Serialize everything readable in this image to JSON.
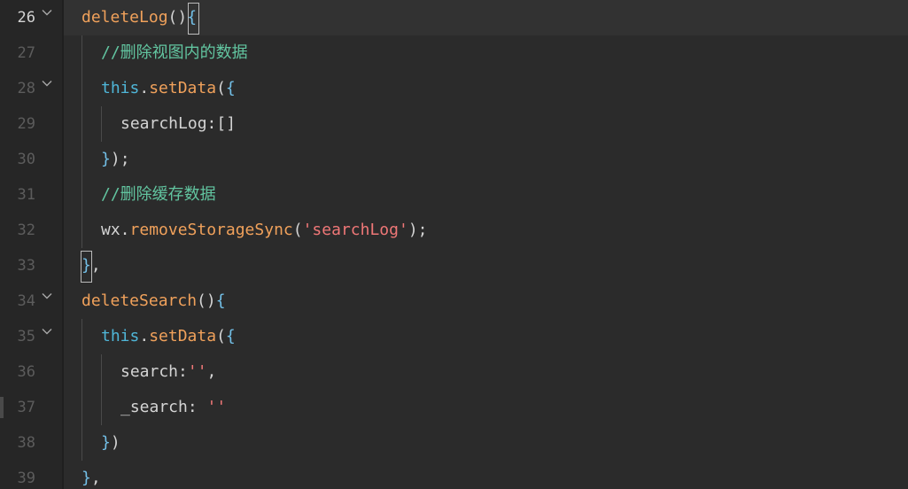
{
  "editor": {
    "current_line": "26",
    "lines": [
      {
        "num": "26",
        "tokens": [
          [
            "fn",
            "deleteLog"
          ],
          [
            "paren",
            "()"
          ],
          [
            "brace",
            "{"
          ]
        ]
      },
      {
        "num": "27",
        "tokens": [
          [
            "cm",
            "//删除视图内的数据"
          ]
        ]
      },
      {
        "num": "28",
        "tokens": [
          [
            "kw",
            "this"
          ],
          [
            "punct",
            "."
          ],
          [
            "fn",
            "setData"
          ],
          [
            "paren",
            "("
          ],
          [
            "brace",
            "{"
          ]
        ]
      },
      {
        "num": "29",
        "tokens": [
          [
            "punct",
            "searchLog:[]"
          ]
        ]
      },
      {
        "num": "30",
        "tokens": [
          [
            "brace",
            "}"
          ],
          [
            "paren",
            ")"
          ],
          [
            "punct",
            ";"
          ]
        ]
      },
      {
        "num": "31",
        "tokens": [
          [
            "cm",
            "//删除缓存数据"
          ]
        ]
      },
      {
        "num": "32",
        "tokens": [
          [
            "punct",
            "wx."
          ],
          [
            "fn",
            "removeStorageSync"
          ],
          [
            "paren",
            "("
          ],
          [
            "str",
            "'searchLog'"
          ],
          [
            "paren",
            ")"
          ],
          [
            "punct",
            ";"
          ]
        ]
      },
      {
        "num": "33",
        "tokens": [
          [
            "brace",
            "}"
          ],
          [
            "punct",
            ","
          ]
        ]
      },
      {
        "num": "34",
        "tokens": [
          [
            "fn",
            "deleteSearch"
          ],
          [
            "paren",
            "()"
          ],
          [
            "brace",
            "{"
          ]
        ]
      },
      {
        "num": "35",
        "tokens": [
          [
            "kw",
            "this"
          ],
          [
            "punct",
            "."
          ],
          [
            "fn",
            "setData"
          ],
          [
            "paren",
            "("
          ],
          [
            "brace",
            "{"
          ]
        ]
      },
      {
        "num": "36",
        "tokens": [
          [
            "punct",
            "search:"
          ],
          [
            "str",
            "''"
          ],
          [
            "punct",
            ","
          ]
        ]
      },
      {
        "num": "37",
        "tokens": [
          [
            "punct",
            "_search: "
          ],
          [
            "str",
            "''"
          ]
        ]
      },
      {
        "num": "38",
        "tokens": [
          [
            "brace",
            "}"
          ],
          [
            "paren",
            ")"
          ]
        ]
      },
      {
        "num": "39",
        "tokens": [
          [
            "brace",
            "}"
          ],
          [
            "punct",
            ","
          ]
        ]
      }
    ]
  },
  "colors": {
    "background": "#2b2b2b",
    "gutter": "#262626",
    "function": "#f0a15b",
    "keyword": "#4fb6d8",
    "string": "#ef7777",
    "comment": "#62c5a0",
    "plain": "#d4d4d4"
  },
  "icons": {
    "fold": "chevron-down-icon"
  }
}
